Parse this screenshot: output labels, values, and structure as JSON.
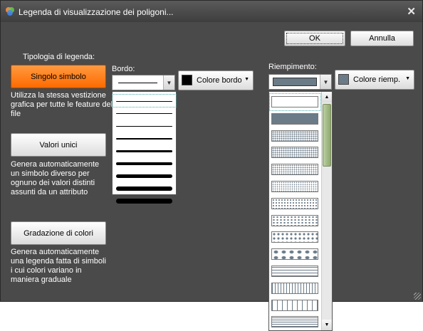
{
  "window": {
    "title": "Legenda di visualizzazione dei poligoni...",
    "close_glyph": "✕",
    "app_icon": "colorful-app-icon"
  },
  "buttons": {
    "ok": "OK",
    "cancel": "Annulla"
  },
  "legend_type": {
    "label": "Tipologia di legenda:",
    "options": [
      {
        "label": "Singolo simbolo",
        "description": [
          "Utilizza la stessa vestizione",
          "grafica per tutte le feature del",
          "file"
        ],
        "selected": true
      },
      {
        "label": "Valori unici",
        "description": [
          "Genera automaticamente",
          "un simbolo diverso per",
          "ognuno dei valori distinti",
          "assunti da un attributo"
        ],
        "selected": false
      },
      {
        "label": "Gradazione di colori",
        "description": [
          "Genera automaticamente",
          "una legenda fatta di simboli",
          "i cui colori variano in",
          "maniera graduale"
        ],
        "selected": false
      }
    ]
  },
  "border": {
    "label": "Bordo:",
    "color_button": "Colore bordo",
    "color": "#000000",
    "line_widths": [
      1,
      1,
      1,
      2,
      3,
      4,
      5,
      6,
      7
    ]
  },
  "fill": {
    "label": "Riempimento:",
    "color_button": "Colore riemp.",
    "color": "#6b7b88",
    "patterns": [
      "empty",
      "solid",
      "dense-dots",
      "dense-dots-2",
      "medium-dots",
      "medium-dots-2",
      "light-dots",
      "lighter-dots",
      "sparse-dots",
      "sparsest-dots",
      "horizontal-lines",
      "vertical-lines",
      "vertical-lines-wide",
      "horizontal-lines-dense"
    ]
  },
  "colors": {
    "accent_orange": "#ff7a10",
    "panel": "#4a4a4a"
  }
}
